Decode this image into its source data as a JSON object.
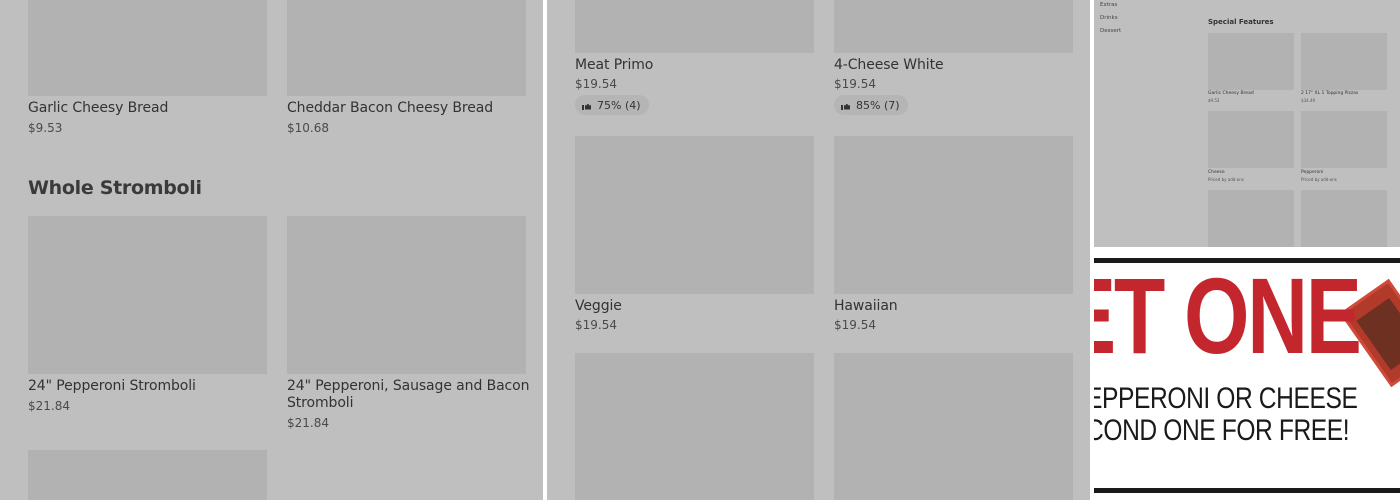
{
  "panel1": {
    "items_top": [
      {
        "name": "Garlic Cheesy Bread",
        "price": "$9.53"
      },
      {
        "name": "Cheddar Bacon Cheesy Bread",
        "price": "$10.68"
      }
    ],
    "section_title": "Whole Stromboli",
    "items": [
      {
        "name": "24\" Pepperoni Stromboli",
        "price": "$21.84"
      },
      {
        "name": "24\" Pepperoni, Sausage and Bacon",
        "name2": "Stromboli",
        "price": "$21.84"
      }
    ]
  },
  "panel2": {
    "items_top": [
      {
        "name": "Meat Primo",
        "price": "$19.54",
        "rating": "75% (4)"
      },
      {
        "name": "4-Cheese White",
        "price": "$19.54",
        "rating": "85% (7)"
      }
    ],
    "items": [
      {
        "name": "Veggie",
        "price": "$19.54"
      },
      {
        "name": "Hawaiian",
        "price": "$19.54"
      }
    ]
  },
  "panel3": {
    "nav": [
      "Extras",
      "Drinks",
      "Dessert"
    ],
    "section_title": "Special Features",
    "items": [
      {
        "name": "Garlic Cheesy Bread",
        "sub": "$9.53"
      },
      {
        "name": "2 17\" XL 1 Topping Pizzas",
        "sub": "$34.49"
      },
      {
        "name": "Cheese",
        "sub": "Priced by add-ons"
      },
      {
        "name": "Pepperoni",
        "sub": "Priced by add-ons"
      }
    ]
  },
  "ad": {
    "headline": "ET ONE",
    "line1": "EPPERONI OR CHEESE",
    "line2": "COND ONE FOR FREE!",
    "accent_color": "#c4262e"
  }
}
